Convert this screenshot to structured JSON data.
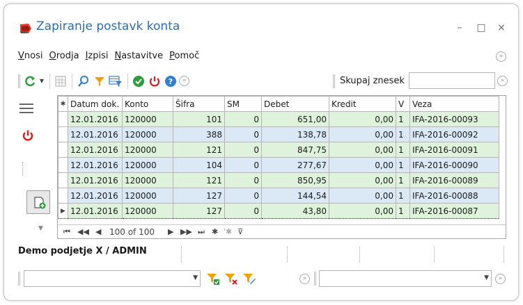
{
  "window": {
    "title": "Zapiranje postavk konta",
    "controls": {
      "minimize": "–",
      "maximize": "□",
      "close": "×"
    }
  },
  "menu": [
    "Vnosi",
    "Orodja",
    "Izpisi",
    "Nastavitve",
    "Pomoč"
  ],
  "toolbar": {
    "sum_label": "Skupaj znesek",
    "sum_value": "",
    "icons": [
      "refresh-icon",
      "dropdown-arrow-icon",
      "grid-layout-icon",
      "search-icon",
      "filter-icon",
      "grid-filter-icon",
      "confirm-icon",
      "power-icon",
      "help-icon",
      "more-icon"
    ],
    "colors": {
      "green": "#2e9b3f",
      "red": "#d81e1e",
      "blue": "#2f7fd6",
      "orange": "#f0a100"
    }
  },
  "grid": {
    "columns": [
      "Datum dok.",
      "Konto",
      "Šifra",
      "SM",
      "Debet",
      "Kredit",
      "V",
      "Veza"
    ],
    "rows": [
      {
        "datum": "12.01.2016",
        "konto": "120000",
        "sifra": "101",
        "sm": "0",
        "debet": "651,00",
        "kredit": "0,00",
        "v": "1",
        "veza": "IFA-2016-00093"
      },
      {
        "datum": "12.01.2016",
        "konto": "120000",
        "sifra": "388",
        "sm": "0",
        "debet": "138,78",
        "kredit": "0,00",
        "v": "1",
        "veza": "IFA-2016-00092"
      },
      {
        "datum": "12.01.2016",
        "konto": "120000",
        "sifra": "121",
        "sm": "0",
        "debet": "847,75",
        "kredit": "0,00",
        "v": "1",
        "veza": "IFA-2016-00091"
      },
      {
        "datum": "12.01.2016",
        "konto": "120000",
        "sifra": "104",
        "sm": "0",
        "debet": "277,67",
        "kredit": "0,00",
        "v": "1",
        "veza": "IFA-2016-00090"
      },
      {
        "datum": "12.01.2016",
        "konto": "120000",
        "sifra": "121",
        "sm": "0",
        "debet": "850,95",
        "kredit": "0,00",
        "v": "1",
        "veza": "IFA-2016-00089"
      },
      {
        "datum": "12.01.2016",
        "konto": "120000",
        "sifra": "127",
        "sm": "0",
        "debet": "144,54",
        "kredit": "0,00",
        "v": "1",
        "veza": "IFA-2016-00088"
      },
      {
        "datum": "12.01.2016",
        "konto": "120000",
        "sifra": "127",
        "sm": "0",
        "debet": "43,80",
        "kredit": "0,00",
        "v": "1",
        "veza": "IFA-2016-00087"
      }
    ],
    "row_colors": {
      "green": "#dff2dc",
      "blue": "#dbe9f7"
    },
    "navigator": {
      "position": "100 of 100"
    }
  },
  "status": {
    "company": "Demo podjetje X / ADMIN"
  },
  "bottom": {
    "left_combo_value": "",
    "right_combo_value": ""
  }
}
